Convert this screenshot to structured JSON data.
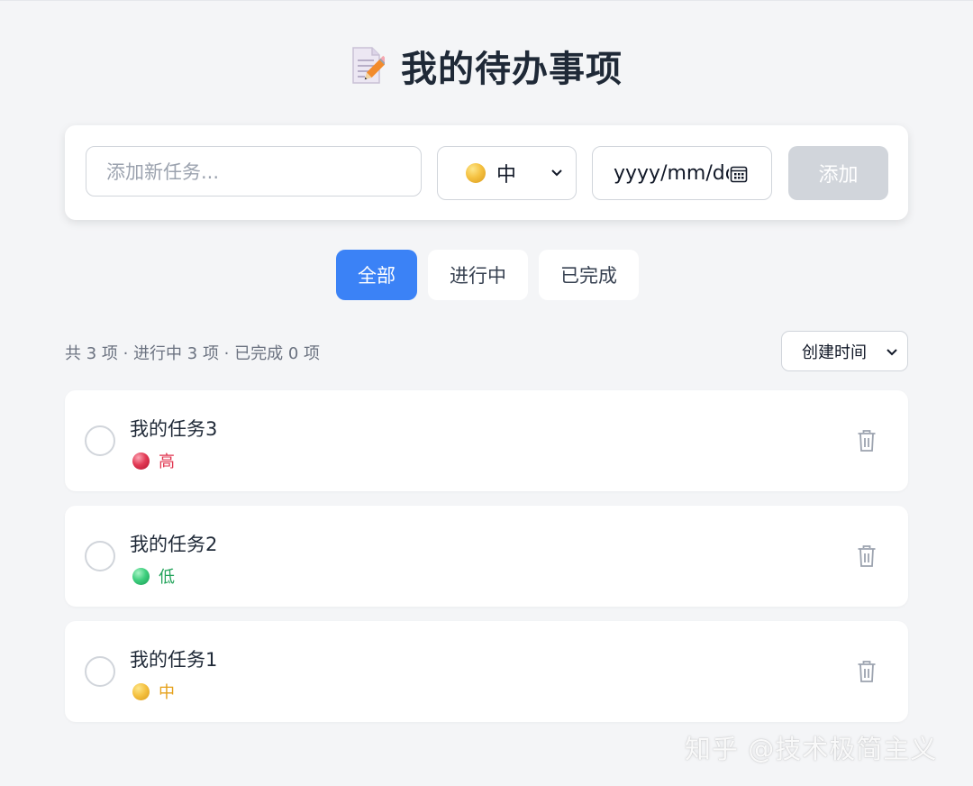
{
  "header": {
    "title": "我的待办事项",
    "icon": "memo-pencil-icon"
  },
  "form": {
    "task_placeholder": "添加新任务...",
    "priority_selected": "中",
    "date_value": "yyyy/mm/dd",
    "add_label": "添加"
  },
  "filters": [
    {
      "label": "全部",
      "active": true
    },
    {
      "label": "进行中",
      "active": false
    },
    {
      "label": "已完成",
      "active": false
    }
  ],
  "stats": "共 3 项 · 进行中 3 项 · 已完成 0 项",
  "sort": {
    "selected": "创建时间"
  },
  "tasks": [
    {
      "title": "我的任务3",
      "priority": "高",
      "priority_color": "#e0354f",
      "completed": false
    },
    {
      "title": "我的任务2",
      "priority": "低",
      "priority_color": "#22a35a",
      "completed": false
    },
    {
      "title": "我的任务1",
      "priority": "中",
      "priority_color": "#e5a019",
      "completed": false
    }
  ],
  "colors": {
    "accent": "#3b82f6",
    "background": "#f4f5f7",
    "button_disabled": "#d1d5db"
  },
  "watermark": "知乎 @技术极简主义"
}
